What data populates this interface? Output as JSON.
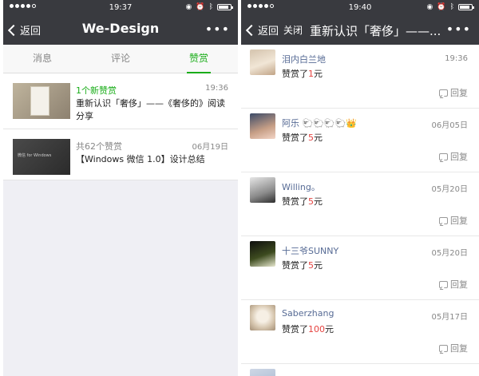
{
  "left_phone": {
    "status": {
      "time": "19:37",
      "battery_level": 0.7
    },
    "nav": {
      "back_label": "返回",
      "title": "We-Design",
      "more_label": "•••"
    },
    "tabs": [
      {
        "label": "消息",
        "active": false
      },
      {
        "label": "评论",
        "active": false
      },
      {
        "label": "赞赏",
        "active": true
      }
    ],
    "messages": [
      {
        "headline": "1个新赞赏",
        "time": "19:36",
        "body": "重新认识「奢侈」——《奢侈的》阅读分享",
        "thumb_text": ""
      },
      {
        "headline": "共62个赞赏",
        "time": "06月19日",
        "body": "【Windows 微信 1.0】设计总结",
        "thumb_text": "微信 for Windows"
      }
    ]
  },
  "right_phone": {
    "status": {
      "time": "19:40",
      "battery_level": 0.7
    },
    "nav": {
      "back_label": "返回",
      "close_label": "关闭",
      "title": "重新认识「奢侈」——...",
      "more_label": "•••"
    },
    "reply_label": "回复",
    "amount_prefix": "赞赏了",
    "amount_suffix": "元",
    "rewards": [
      {
        "name": "泪内白兰地",
        "time": "19:36",
        "amount": "1"
      },
      {
        "name": "阿乐 🐑🐑🐑🐑👑",
        "time": "06月05日",
        "amount": "5"
      },
      {
        "name": "Willing。",
        "time": "05月20日",
        "amount": "5"
      },
      {
        "name": "十三爷SUNNY",
        "time": "05月20日",
        "amount": "5"
      },
      {
        "name": "Saberzhang",
        "time": "05月17日",
        "amount": "100"
      }
    ]
  }
}
